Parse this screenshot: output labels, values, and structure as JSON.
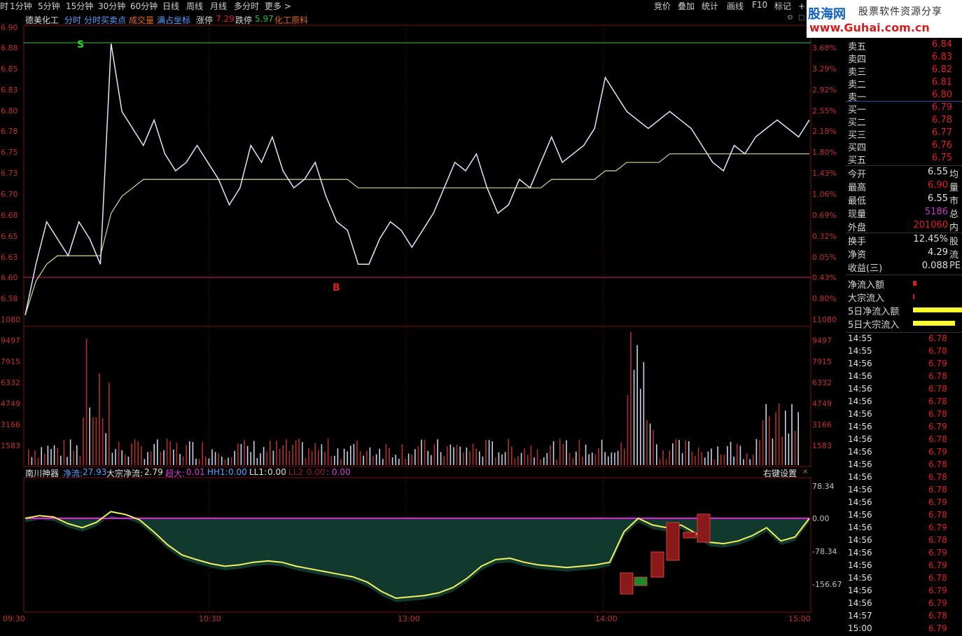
{
  "topbar": {
    "items": [
      "时",
      "1分钟",
      "5分钟",
      "15分钟",
      "30分钟",
      "60分钟",
      "日线",
      "周线",
      "月线",
      "多分时",
      "更多 >"
    ],
    "right_items": [
      "竞价",
      "叠加",
      "统计",
      "画线",
      "F10",
      "标记",
      "+自"
    ]
  },
  "info": {
    "stock_name": "德美化工",
    "tab_fenshi": "分时",
    "tab_buysell": "分时买卖点",
    "tab_volume": "成交量",
    "tab_full": "满占坐标",
    "limit_up_label": "涨停",
    "limit_up": "7.29",
    "limit_down_label": "跌停",
    "limit_down": "5.97",
    "sector": "化工原料"
  },
  "logo": {
    "cn": "股海网",
    "slogan": "股票软件资源分享",
    "url": "www.Guhai.com.cn"
  },
  "price_axis": {
    "left": [
      "6.90",
      "6.88",
      "6.85",
      "6.83",
      "6.80",
      "6.78",
      "6.75",
      "6.73",
      "6.70",
      "6.68",
      "6.65",
      "6.63",
      "6.60",
      "6.58",
      "1080"
    ],
    "right": [
      "3.68%",
      "3.29%",
      "2.92%",
      "2.55%",
      "2.18%",
      "1.80%",
      "1.43%",
      "1.06%",
      "0.69%",
      "0.32%",
      "0.05%",
      "0.43%",
      "0.80%",
      "11080"
    ]
  },
  "volume_axis": [
    "9497",
    "7915",
    "6332",
    "4749",
    "3166",
    "1583"
  ],
  "indicator": {
    "name": "南川神器",
    "net_label": "净流:",
    "net_value": "27.93",
    "big_label": "大宗净流:",
    "big_value": "2.79",
    "super_label": "超大:",
    "super_value": "0.01",
    "hh1_label": "HH1:",
    "hh1_value": "0.00",
    "ll1_label": "LL1:",
    "ll1_value": "0.00",
    "ll2_label": "LL2",
    "ll2_value": "0.00",
    "last_value": ": 0.00",
    "settings": "右键设置",
    "axis": [
      "78.34",
      "0.00",
      "-78.34",
      "-156.67"
    ]
  },
  "time_axis": [
    "09:30",
    "10:30",
    "13:00",
    "14:00",
    "15:00"
  ],
  "signals": {
    "sell": "S",
    "buy": "B"
  },
  "orderbook": {
    "asks": [
      {
        "label": "卖五",
        "value": "6.84"
      },
      {
        "label": "卖四",
        "value": "6.83"
      },
      {
        "label": "卖三",
        "value": "6.82"
      },
      {
        "label": "卖二",
        "value": "6.81"
      },
      {
        "label": "卖一",
        "value": "6.80"
      }
    ],
    "bids": [
      {
        "label": "买一",
        "value": "6.79"
      },
      {
        "label": "买二",
        "value": "6.78"
      },
      {
        "label": "买三",
        "value": "6.77"
      },
      {
        "label": "买四",
        "value": "6.76"
      },
      {
        "label": "买五",
        "value": "6.75"
      }
    ]
  },
  "quote": [
    {
      "label": "今开",
      "value": "6.55",
      "extra": "均"
    },
    {
      "label": "最高",
      "value": "6.90",
      "extra": "量"
    },
    {
      "label": "最低",
      "value": "6.55",
      "extra": "市"
    },
    {
      "label": "现量",
      "value": "5186",
      "extra": "总"
    },
    {
      "label": "外盘",
      "value": "201060",
      "extra": "内"
    }
  ],
  "quote2": [
    {
      "label": "换手",
      "value": "12.45%",
      "extra": "股"
    },
    {
      "label": "净资",
      "value": "4.29",
      "extra": "流"
    },
    {
      "label": "收益(三)",
      "value": "0.088",
      "extra": "PE"
    }
  ],
  "flows": [
    {
      "label": "净流入额"
    },
    {
      "label": "大宗流入"
    },
    {
      "label": "5日净流入额"
    },
    {
      "label": "5日大宗流入"
    }
  ],
  "trades": [
    {
      "t": "14:55",
      "p": "6.78"
    },
    {
      "t": "14:55",
      "p": "6.78"
    },
    {
      "t": "14:56",
      "p": "6.79"
    },
    {
      "t": "14:56",
      "p": "6.78"
    },
    {
      "t": "14:56",
      "p": "6.78"
    },
    {
      "t": "14:56",
      "p": "6.78"
    },
    {
      "t": "14:56",
      "p": "6.78"
    },
    {
      "t": "14:56",
      "p": "6.79"
    },
    {
      "t": "14:56",
      "p": "6.78"
    },
    {
      "t": "14:56",
      "p": "6.79"
    },
    {
      "t": "14:56",
      "p": "6.78"
    },
    {
      "t": "14:56",
      "p": "6.78"
    },
    {
      "t": "14:56",
      "p": "6.78"
    },
    {
      "t": "14:56",
      "p": "6.79"
    },
    {
      "t": "14:56",
      "p": "6.78"
    },
    {
      "t": "14:56",
      "p": "6.79"
    },
    {
      "t": "14:56",
      "p": "6.78"
    },
    {
      "t": "14:56",
      "p": "6.79"
    },
    {
      "t": "14:56",
      "p": "6.79"
    },
    {
      "t": "14:56",
      "p": "6.78"
    },
    {
      "t": "14:56",
      "p": "6.79"
    },
    {
      "t": "14:56",
      "p": "6.79"
    },
    {
      "t": "14:57",
      "p": "6.78"
    },
    {
      "t": "15:00",
      "p": "6.79"
    }
  ],
  "colors": {
    "price_line": "#dce8ff",
    "avg_line": "#d8d890",
    "up": "#d02020",
    "down": "#20b040",
    "green_area": "#12392e",
    "red_area": "#6a2a2a",
    "zero_line": "#e020e0",
    "flow_bar": "#ffff30"
  },
  "chart_data": {
    "type": "line",
    "x_range": [
      "09:30",
      "15:00"
    ],
    "ylim": [
      6.55,
      6.9
    ],
    "price": [
      6.56,
      6.62,
      6.67,
      6.65,
      6.63,
      6.67,
      6.65,
      6.62,
      6.88,
      6.8,
      6.78,
      6.76,
      6.79,
      6.75,
      6.73,
      6.74,
      6.76,
      6.74,
      6.72,
      6.69,
      6.71,
      6.76,
      6.74,
      6.77,
      6.73,
      6.71,
      6.72,
      6.74,
      6.7,
      6.67,
      6.66,
      6.62,
      6.62,
      6.65,
      6.67,
      6.66,
      6.64,
      6.66,
      6.68,
      6.71,
      6.74,
      6.73,
      6.75,
      6.71,
      6.68,
      6.69,
      6.72,
      6.71,
      6.74,
      6.77,
      6.74,
      6.75,
      6.76,
      6.78,
      6.84,
      6.82,
      6.8,
      6.79,
      6.78,
      6.79,
      6.8,
      6.79,
      6.78,
      6.76,
      6.74,
      6.73,
      6.76,
      6.75,
      6.77,
      6.78,
      6.79,
      6.78,
      6.77,
      6.79
    ],
    "avg": [
      6.56,
      6.6,
      6.62,
      6.63,
      6.63,
      6.63,
      6.63,
      6.63,
      6.68,
      6.7,
      6.71,
      6.72,
      6.72,
      6.72,
      6.72,
      6.72,
      6.72,
      6.72,
      6.72,
      6.72,
      6.72,
      6.72,
      6.72,
      6.72,
      6.72,
      6.72,
      6.72,
      6.72,
      6.72,
      6.72,
      6.72,
      6.71,
      6.71,
      6.71,
      6.71,
      6.71,
      6.71,
      6.71,
      6.71,
      6.71,
      6.71,
      6.71,
      6.71,
      6.71,
      6.71,
      6.71,
      6.71,
      6.71,
      6.71,
      6.72,
      6.72,
      6.72,
      6.72,
      6.72,
      6.73,
      6.73,
      6.74,
      6.74,
      6.74,
      6.74,
      6.75,
      6.75,
      6.75,
      6.75,
      6.75,
      6.75,
      6.75,
      6.75,
      6.75,
      6.75,
      6.75,
      6.75,
      6.75,
      6.75
    ],
    "volume_ylim": [
      0,
      9497
    ],
    "indicator_ylim": [
      -195,
      100
    ]
  }
}
